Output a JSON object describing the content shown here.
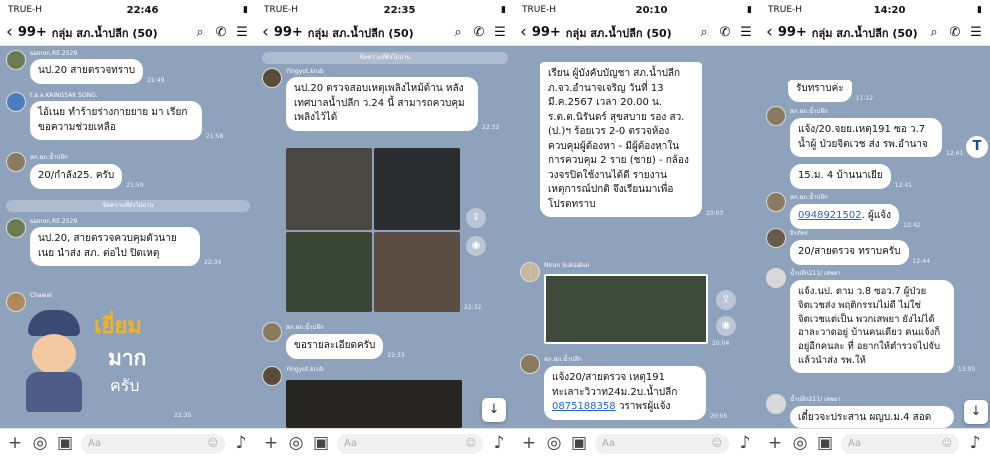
{
  "colors": {
    "chat_bg": "#8ea2bc",
    "bubble": "#ffffff",
    "link": "#2a60d8"
  },
  "header": {
    "unread": "99+",
    "title": "กลุ่ม สภ.น้ำปลีก (50)"
  },
  "input": {
    "placeholder": "Aa"
  },
  "panel1": {
    "status": {
      "carrier": "TRUE-H",
      "time": "22:46"
    },
    "messages": [
      {
        "sender": "samon.RE.2529",
        "text": "นป.20 สายตรวจทราบ",
        "time": "21:49"
      },
      {
        "sender": "t.a.a.KAINGSAK SONG.",
        "text": "ไอ้เนย ทำร้ายร่างกายยาย มา เรียกขอความช่วยเหลือ",
        "time": "21:58"
      },
      {
        "sender": "สภ.สภ.น้ำปลีก",
        "text": "20/กำลัง25. ครับ",
        "time": "21:59"
      },
      {
        "sender": "samon.RE.2529",
        "text": "นป.20, สายตรวจควบคุมตัวนาย เนย นำส่ง สภ. ต่อไป ปิดเหตุ",
        "time": "22:34"
      },
      {
        "sender": "Chawal",
        "time": "22:35"
      }
    ],
    "divider": "ข้อความที่ยังไม่อ่าน",
    "sticker": {
      "line1": "เยี่ยม",
      "line2": "มาก",
      "line3": "ครับ"
    }
  },
  "panel2": {
    "status": {
      "carrier": "TRUE-H",
      "time": "22:35"
    },
    "divider": "ข้อความที่ยังไม่อ่าน",
    "messages": [
      {
        "sender": "Yingyot.krub",
        "text": "นป.20 ตรวจสอบเหตุเพลิงไหม้ด้าน หลังเทศบาลน้ำปลีก ว.24 นี้ สามารถควบคุมเพลิงไว้ได้",
        "time": "22:32"
      },
      {
        "time": "22:32"
      },
      {
        "sender": "สภ.สภ.น้ำปลีก",
        "text": "ขอรายละเอียดครับ",
        "time": "22:33"
      },
      {
        "sender": "Yingyot.krub"
      }
    ]
  },
  "panel3": {
    "status": {
      "carrier": "TRUE-H",
      "time": "20:10"
    },
    "messages": [
      {
        "text": "เรียน ผู้บังคับบัญชา สภ.น้ำปลีก ภ.จว.อำนาจเจริญ วันที่ 13 มี.ค.2567 เวลา 20.00 น. ร.ต.ต.นิรันดร์ สุขสบาย รอง สว.(ป.)ฯ ร้อยเวร 2-0 ตรวจห้องควบคุมผู้ต้องหา - มีผู้ต้องหาในการควบคุม 2 ราย (ชาย) - กล้องวงจรปิดใช้งานได้ดี รายงานเหตุการณ์ปกติ จึงเรียนมาเพื่อโปรดทราบ",
        "time": "20:03"
      },
      {
        "sender": "Nirun Suksabai",
        "time": "20:04"
      },
      {
        "sender": "สภ.สภ.น้ำปลีก",
        "text": "แจ้ง20/สายตรวจ เหตุ191 ทะเลาะวิวาท24ม.2บ.น้ำปลีก",
        "link": "0875188358",
        "link_suffix": "วราพรผู้แจ้ง",
        "time": "20:05"
      }
    ]
  },
  "panel4": {
    "status": {
      "carrier": "TRUE-H",
      "time": "14:20"
    },
    "messages": [
      {
        "text": "รับทราบค่ะ",
        "time": "11:12"
      },
      {
        "sender": "สภ.สภ.น้ำปลีก",
        "text": "แจ้ง/20.จยย.เหตุ191 ซอ ว.7 น้ำผู้ ป่วยจิตเวช ส่ง รพ.อำนาจ",
        "time": "12:41"
      },
      {
        "text": "15.ม. 4 บ้านนาเยีย",
        "time": "12:41"
      },
      {
        "sender": "สภ.สภ.น้ำปลีก",
        "link": "0948921502",
        "text": ". ผู้แจ้ง",
        "time": "12:42"
      },
      {
        "sender": "จิรภัทร",
        "text": "20/สายตรวจ ทราบครับ",
        "time": "12:44"
      },
      {
        "sender": "น้ำปลีก211/ เสพยา",
        "text": "แจ้ง.นป. ตาม ว.8 ซอว.7 ผู้ป่วยจิตเวชส่ง พฤติกรรมไม่ดี ไม่ใช่จิตเวชแต่เป็น พวกเสพยา ยังไม่ได้อาละวาดอยู่ บ้านคนเดียว คนแจ้งก็อยู่อีกคนละ ที่ อยากให้ตำรวจไปจับแล้วนำส่ง รพ.ให้",
        "time": "13:05"
      },
      {
        "sender": "น้ำปลีก211/ เสพยา",
        "text": "เดี๋ยวจะประสาน ผญบ.ม.4 สอด"
      }
    ]
  }
}
